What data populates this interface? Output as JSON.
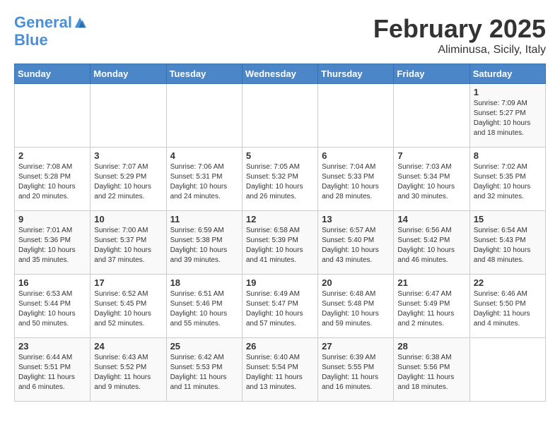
{
  "logo": {
    "line1": "General",
    "line2": "Blue"
  },
  "title": "February 2025",
  "location": "Aliminusa, Sicily, Italy",
  "weekdays": [
    "Sunday",
    "Monday",
    "Tuesday",
    "Wednesday",
    "Thursday",
    "Friday",
    "Saturday"
  ],
  "weeks": [
    [
      {
        "day": "",
        "info": ""
      },
      {
        "day": "",
        "info": ""
      },
      {
        "day": "",
        "info": ""
      },
      {
        "day": "",
        "info": ""
      },
      {
        "day": "",
        "info": ""
      },
      {
        "day": "",
        "info": ""
      },
      {
        "day": "1",
        "info": "Sunrise: 7:09 AM\nSunset: 5:27 PM\nDaylight: 10 hours\nand 18 minutes."
      }
    ],
    [
      {
        "day": "2",
        "info": "Sunrise: 7:08 AM\nSunset: 5:28 PM\nDaylight: 10 hours\nand 20 minutes."
      },
      {
        "day": "3",
        "info": "Sunrise: 7:07 AM\nSunset: 5:29 PM\nDaylight: 10 hours\nand 22 minutes."
      },
      {
        "day": "4",
        "info": "Sunrise: 7:06 AM\nSunset: 5:31 PM\nDaylight: 10 hours\nand 24 minutes."
      },
      {
        "day": "5",
        "info": "Sunrise: 7:05 AM\nSunset: 5:32 PM\nDaylight: 10 hours\nand 26 minutes."
      },
      {
        "day": "6",
        "info": "Sunrise: 7:04 AM\nSunset: 5:33 PM\nDaylight: 10 hours\nand 28 minutes."
      },
      {
        "day": "7",
        "info": "Sunrise: 7:03 AM\nSunset: 5:34 PM\nDaylight: 10 hours\nand 30 minutes."
      },
      {
        "day": "8",
        "info": "Sunrise: 7:02 AM\nSunset: 5:35 PM\nDaylight: 10 hours\nand 32 minutes."
      }
    ],
    [
      {
        "day": "9",
        "info": "Sunrise: 7:01 AM\nSunset: 5:36 PM\nDaylight: 10 hours\nand 35 minutes."
      },
      {
        "day": "10",
        "info": "Sunrise: 7:00 AM\nSunset: 5:37 PM\nDaylight: 10 hours\nand 37 minutes."
      },
      {
        "day": "11",
        "info": "Sunrise: 6:59 AM\nSunset: 5:38 PM\nDaylight: 10 hours\nand 39 minutes."
      },
      {
        "day": "12",
        "info": "Sunrise: 6:58 AM\nSunset: 5:39 PM\nDaylight: 10 hours\nand 41 minutes."
      },
      {
        "day": "13",
        "info": "Sunrise: 6:57 AM\nSunset: 5:40 PM\nDaylight: 10 hours\nand 43 minutes."
      },
      {
        "day": "14",
        "info": "Sunrise: 6:56 AM\nSunset: 5:42 PM\nDaylight: 10 hours\nand 46 minutes."
      },
      {
        "day": "15",
        "info": "Sunrise: 6:54 AM\nSunset: 5:43 PM\nDaylight: 10 hours\nand 48 minutes."
      }
    ],
    [
      {
        "day": "16",
        "info": "Sunrise: 6:53 AM\nSunset: 5:44 PM\nDaylight: 10 hours\nand 50 minutes."
      },
      {
        "day": "17",
        "info": "Sunrise: 6:52 AM\nSunset: 5:45 PM\nDaylight: 10 hours\nand 52 minutes."
      },
      {
        "day": "18",
        "info": "Sunrise: 6:51 AM\nSunset: 5:46 PM\nDaylight: 10 hours\nand 55 minutes."
      },
      {
        "day": "19",
        "info": "Sunrise: 6:49 AM\nSunset: 5:47 PM\nDaylight: 10 hours\nand 57 minutes."
      },
      {
        "day": "20",
        "info": "Sunrise: 6:48 AM\nSunset: 5:48 PM\nDaylight: 10 hours\nand 59 minutes."
      },
      {
        "day": "21",
        "info": "Sunrise: 6:47 AM\nSunset: 5:49 PM\nDaylight: 11 hours\nand 2 minutes."
      },
      {
        "day": "22",
        "info": "Sunrise: 6:46 AM\nSunset: 5:50 PM\nDaylight: 11 hours\nand 4 minutes."
      }
    ],
    [
      {
        "day": "23",
        "info": "Sunrise: 6:44 AM\nSunset: 5:51 PM\nDaylight: 11 hours\nand 6 minutes."
      },
      {
        "day": "24",
        "info": "Sunrise: 6:43 AM\nSunset: 5:52 PM\nDaylight: 11 hours\nand 9 minutes."
      },
      {
        "day": "25",
        "info": "Sunrise: 6:42 AM\nSunset: 5:53 PM\nDaylight: 11 hours\nand 11 minutes."
      },
      {
        "day": "26",
        "info": "Sunrise: 6:40 AM\nSunset: 5:54 PM\nDaylight: 11 hours\nand 13 minutes."
      },
      {
        "day": "27",
        "info": "Sunrise: 6:39 AM\nSunset: 5:55 PM\nDaylight: 11 hours\nand 16 minutes."
      },
      {
        "day": "28",
        "info": "Sunrise: 6:38 AM\nSunset: 5:56 PM\nDaylight: 11 hours\nand 18 minutes."
      },
      {
        "day": "",
        "info": ""
      }
    ]
  ]
}
